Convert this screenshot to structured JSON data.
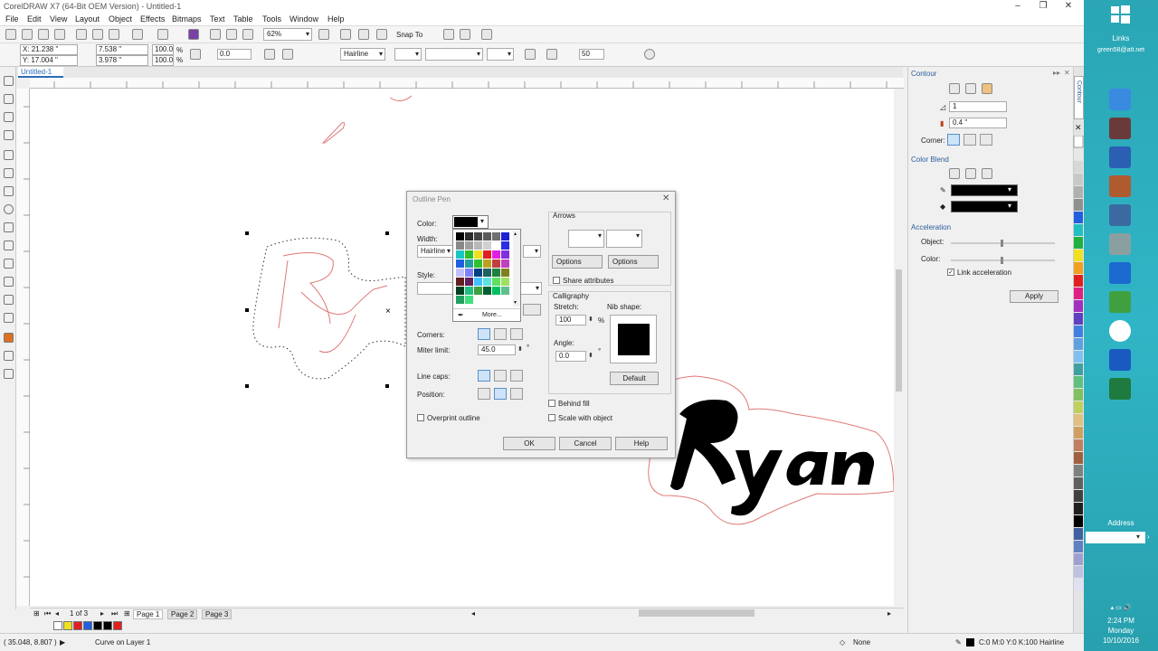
{
  "window": {
    "title": "CorelDRAW X7 (64-Bit OEM Version) - Untitled-1"
  },
  "menu": [
    "File",
    "Edit",
    "View",
    "Layout",
    "Object",
    "Effects",
    "Bitmaps",
    "Text",
    "Table",
    "Tools",
    "Window",
    "Help"
  ],
  "toolbar": {
    "zoom": "62%",
    "snap_to": "Snap To"
  },
  "property_bar": {
    "x": "X: 21.238 \"",
    "y": "Y: 17.004 \"",
    "w": "7.538 \"",
    "h": "3.978 \"",
    "scale_x": "100.0",
    "scale_y": "100.0",
    "pct": "%",
    "rotation": "0.0",
    "outline_width": "Hairline",
    "miter": "50"
  },
  "document_tab": "Untitled-1",
  "page_nav": {
    "count": "1 of 3",
    "pages": [
      "Page 1",
      "Page 2",
      "Page 3"
    ]
  },
  "status": {
    "coords": "( 35.048, 8.807 )",
    "message": "Curve on Layer 1",
    "fill": "None",
    "outline": "C:0 M:0 Y:0 K:100  Hairline"
  },
  "docker": {
    "title": "Contour",
    "steps": "1",
    "offset": "0.4 \"",
    "corner_label": "Corner:",
    "color_blend_label": "Color Blend",
    "acceleration_label": "Acceleration",
    "object_label": "Object:",
    "color_label": "Color:",
    "link_label": "Link acceleration",
    "apply_label": "Apply",
    "side_tab": "Contour"
  },
  "dialog": {
    "title": "Outline Pen",
    "color_label": "Color:",
    "width_label": "Width:",
    "width_value": "Hairline",
    "style_label": "Style:",
    "corners_label": "Corners:",
    "miter_label": "Miter limit:",
    "miter_value": "45.0",
    "degree": "°",
    "line_caps_label": "Line caps:",
    "position_label": "Position:",
    "overprint_label": "Overprint outline",
    "arrows_label": "Arrows",
    "options1": "Options",
    "options2": "Options",
    "share_label": "Share attributes",
    "calligraphy_label": "Calligraphy",
    "stretch_label": "Stretch:",
    "stretch_value": "100",
    "pct": "%",
    "nib_label": "Nib shape:",
    "angle_label": "Angle:",
    "angle_value": "0.0",
    "default_label": "Default",
    "behind_fill_label": "Behind fill",
    "scale_label": "Scale with object",
    "ok": "OK",
    "cancel": "Cancel",
    "help": "Help",
    "more": "More..."
  },
  "taskbar": {
    "links": "Links",
    "email": "green58@att.net",
    "address": "Address",
    "time": "2:24 PM",
    "day": "Monday",
    "date": "10/10/2016"
  },
  "colors": {
    "palette": [
      "#000000",
      "#2b2b2b",
      "#444444",
      "#5a5a5a",
      "#707070",
      "#1f1fd6",
      "#888888",
      "#a0a0a0",
      "#b8b8b8",
      "#d0d0d0",
      "#ffffff",
      "#2d2de6",
      "#18c6c6",
      "#2bbf2b",
      "#f0e020",
      "#e02020",
      "#e020e0",
      "#8030e0",
      "#2060e0",
      "#20a0a0",
      "#30c030",
      "#c0a020",
      "#c04040",
      "#c040c0",
      "#c0c0ff",
      "#8080ff",
      "#004080",
      "#206060",
      "#208040",
      "#808020",
      "#602020",
      "#602060",
      "#40c0ff",
      "#60e0e0",
      "#60e060",
      "#a0e060",
      "#004020",
      "#20c080",
      "#40a040",
      "#006030",
      "#00c060",
      "#60c090",
      "#20a060",
      "#40e080"
    ]
  }
}
